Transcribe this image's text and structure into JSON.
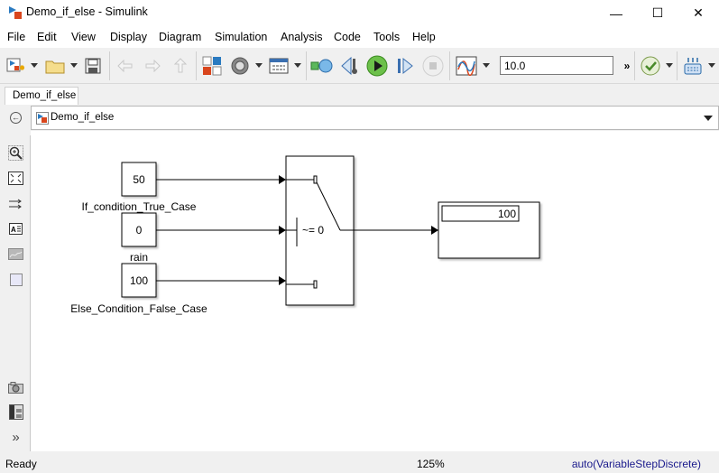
{
  "window": {
    "title": "Demo_if_else - Simulink",
    "controls": {
      "minimize": "—",
      "maximize": "☐",
      "close": "✕"
    }
  },
  "menu": [
    "File",
    "Edit",
    "View",
    "Display",
    "Diagram",
    "Simulation",
    "Analysis",
    "Code",
    "Tools",
    "Help"
  ],
  "toolbar": {
    "stop_time": "10.0",
    "overflow": "»",
    "icons": [
      "new-model-icon",
      "open-icon",
      "save-icon",
      "back-icon",
      "forward-icon",
      "up-icon",
      "library-browser-icon",
      "model-settings-icon",
      "model-explorer-icon",
      "update-diagram-icon",
      "step-back-icon",
      "run-icon",
      "step-forward-icon",
      "stop-icon",
      "scope-icon",
      "model-advisor-icon",
      "build-icon"
    ]
  },
  "tab": {
    "label": "Demo_if_else"
  },
  "address": {
    "path": "Demo_if_else"
  },
  "palette": [
    "zoom-icon",
    "fit-view-icon",
    "route-lines-icon",
    "annotation-icon",
    "image-icon",
    "area-icon",
    "snapshot-icon",
    "model-browser-icon",
    "expand-icon"
  ],
  "diagram": {
    "constants": [
      {
        "value": "50",
        "label": "If_condition_True_Case"
      },
      {
        "value": "0",
        "label": "rain"
      },
      {
        "value": "100",
        "label": "Else_Condition_False_Case"
      }
    ],
    "switch": {
      "criteria": "~= 0"
    },
    "display": {
      "value": "100"
    }
  },
  "status": {
    "state": "Ready",
    "zoom": "125%",
    "solver": "auto(VariableStepDiscrete)"
  }
}
